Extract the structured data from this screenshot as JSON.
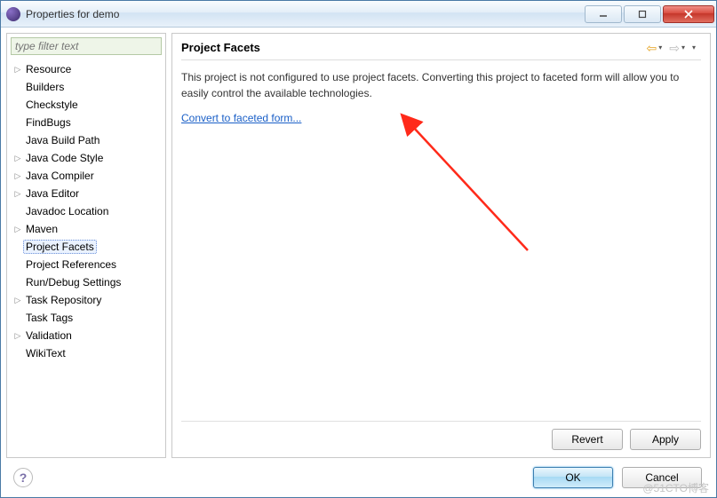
{
  "window": {
    "title": "Properties for demo"
  },
  "filter": {
    "placeholder": "type filter text"
  },
  "tree": {
    "items": [
      {
        "label": "Resource",
        "expandable": true
      },
      {
        "label": "Builders",
        "expandable": false
      },
      {
        "label": "Checkstyle",
        "expandable": false
      },
      {
        "label": "FindBugs",
        "expandable": false
      },
      {
        "label": "Java Build Path",
        "expandable": false
      },
      {
        "label": "Java Code Style",
        "expandable": true
      },
      {
        "label": "Java Compiler",
        "expandable": true
      },
      {
        "label": "Java Editor",
        "expandable": true
      },
      {
        "label": "Javadoc Location",
        "expandable": false
      },
      {
        "label": "Maven",
        "expandable": true
      },
      {
        "label": "Project Facets",
        "expandable": false,
        "selected": true
      },
      {
        "label": "Project References",
        "expandable": false
      },
      {
        "label": "Run/Debug Settings",
        "expandable": false
      },
      {
        "label": "Task Repository",
        "expandable": true
      },
      {
        "label": "Task Tags",
        "expandable": false
      },
      {
        "label": "Validation",
        "expandable": true
      },
      {
        "label": "WikiText",
        "expandable": false
      }
    ]
  },
  "page": {
    "heading": "Project Facets",
    "description": "This project is not configured to use project facets. Converting this project to faceted form will allow you to easily control the available technologies.",
    "link": "Convert to faceted form..."
  },
  "buttons": {
    "revert": "Revert",
    "apply": "Apply",
    "ok": "OK",
    "cancel": "Cancel"
  },
  "watermark": "@51CTO博客"
}
